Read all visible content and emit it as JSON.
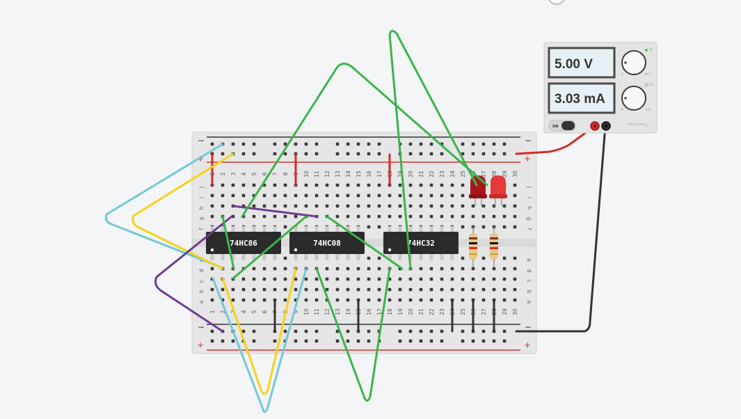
{
  "power_supply": {
    "voltage_display": "5.00 V",
    "current_display": "3.03 mA",
    "switch_label": "ON",
    "voltage_knob_label": "30 V",
    "current_knob_label": "5 A",
    "knob_min_label": "0",
    "cv_label": "VC",
    "cc_label": "CC",
    "brand_label": "POWER SUPPLY"
  },
  "chips": [
    {
      "label": "74HC86"
    },
    {
      "label": "74HC08"
    },
    {
      "label": "74HC32"
    }
  ],
  "breadboard": {
    "row_letters_top": [
      "j",
      "i",
      "h",
      "g",
      "f"
    ],
    "row_letters_bottom": [
      "e",
      "d",
      "c",
      "b",
      "a"
    ],
    "column_numbers": [
      "1",
      "2",
      "3",
      "4",
      "5",
      "6",
      "7",
      "8",
      "9",
      "10",
      "11",
      "12",
      "13",
      "14",
      "15",
      "16",
      "17",
      "18",
      "19",
      "20",
      "21",
      "22",
      "23",
      "24",
      "25",
      "26",
      "27",
      "28",
      "29",
      "30"
    ],
    "rail_minus": "−",
    "rail_plus": "+"
  },
  "colors": {
    "wire_green": "#3bb44a",
    "wire_yellow": "#f5d21b",
    "wire_cyan": "#72c8d6",
    "wire_purple": "#6b3d8f",
    "wire_red": "#d42a2a",
    "wire_black": "#333333",
    "chip": "#2b2b2b",
    "board": "#e6e6e6"
  }
}
